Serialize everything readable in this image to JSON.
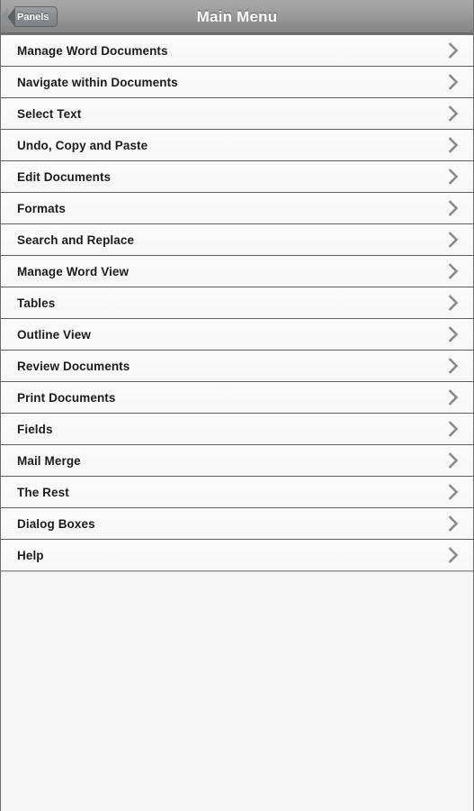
{
  "header": {
    "title": "Main Menu",
    "back_label": "Panels",
    "back_icon": "chevron-left-icon"
  },
  "menu": {
    "row_icon": "chevron-right-icon",
    "items": [
      {
        "label": "Manage Word Documents"
      },
      {
        "label": "Navigate within Documents"
      },
      {
        "label": "Select Text"
      },
      {
        "label": "Undo, Copy and Paste"
      },
      {
        "label": "Edit Documents"
      },
      {
        "label": "Formats"
      },
      {
        "label": "Search and Replace"
      },
      {
        "label": "Manage Word View"
      },
      {
        "label": "Tables"
      },
      {
        "label": "Outline View"
      },
      {
        "label": "Review Documents"
      },
      {
        "label": "Print Documents"
      },
      {
        "label": "Fields"
      },
      {
        "label": "Mail Merge"
      },
      {
        "label": "The Rest"
      },
      {
        "label": "Dialog Boxes"
      },
      {
        "label": "Help"
      }
    ]
  },
  "colors": {
    "navbar_top": "#a8a8a8",
    "navbar_bottom": "#858585",
    "row_background": "#fbfbfb",
    "row_separator": "#5f5f5f",
    "label_text": "#1c1c1c",
    "chevron": "#8a8a8a",
    "title_text": "#ffffff",
    "page_background": "#f6f6f6"
  }
}
